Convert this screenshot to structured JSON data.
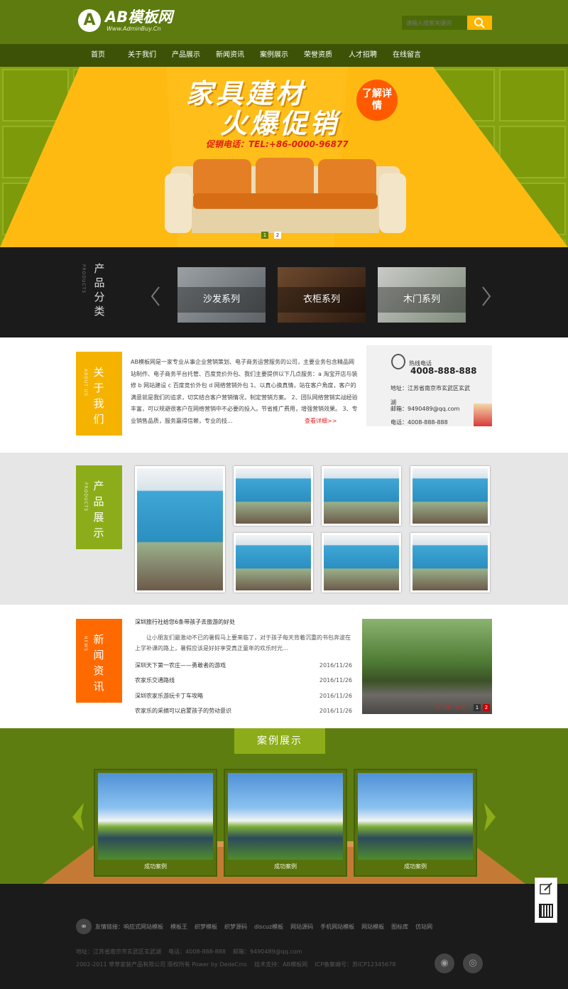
{
  "header": {
    "logo_text": "AB模板网",
    "logo_url": "Www.AdminBuy.Cn",
    "search_placeholder": "请输入搜索关键词"
  },
  "nav": [
    "首页",
    "关于我们",
    "产品展示",
    "新闻资讯",
    "案例展示",
    "荣誉资质",
    "人才招聘",
    "在线留言"
  ],
  "banner": {
    "title_line1": "家具建材",
    "title_line2": "火爆促销",
    "badge": "了解详情",
    "phone": "促销电话：TEL:+86-0000-96877",
    "dots": [
      "1",
      "2"
    ]
  },
  "categories": {
    "title": "产品分类",
    "subtitle": "PRODUCTS",
    "items": [
      "沙发系列",
      "衣柜系列",
      "木门系列"
    ]
  },
  "about": {
    "title": "关于我们",
    "subtitle": "ABOUT US",
    "text": "AB模板网是一家专业从事企业营销策划、电子商务运营服务的公司，主要业务包含精品网站制作、电子商务平台托管、百度竞价外包、我们主要提供以下几点服务：a 淘宝开店与装修 b 网站建设 c 百度竞价外包 d 网络营销外包 1、以真心换真情，站在客户角度，客户的满意就是我们的追求，切实结合客户营销情况，制定营销方案。 2、团队网络营销实战经验丰富，可以规避很客户在网络营销中不必要的投入。节省推广费用，增强营销效果。 3、专业销售品质，服务赢得信赖，专业的技...",
    "more": "查看详细>>",
    "hotline_label": "热线电话",
    "hotline": "4008-888-888",
    "address": "地址：江苏省南京市玄武区玄武湖",
    "email": "邮箱：9490489@qq.com",
    "phone": "电话：4008-888-888"
  },
  "products": {
    "title": "产品展示",
    "subtitle": "PRODUCTS"
  },
  "news": {
    "title": "新闻资讯",
    "subtitle": "NEWS",
    "headline": "深圳旅行社给您6条带孩子去旅游的好处",
    "summary": "让小朋友们最激动不已的暑假马上要来临了，对于孩子每天背着沉重的书包奔波在上学补课的路上，暑假应该是好好享受真正童年的欢乐时光...",
    "items": [
      {
        "title": "深圳天下第一农庄——勇敢者的游戏",
        "date": "2016/11/26"
      },
      {
        "title": "农家乐交通路线",
        "date": "2016/11/26"
      },
      {
        "title": "深圳农家乐游玩卡丁车攻略",
        "date": "2016/11/26"
      },
      {
        "title": "农家乐的采摘可以启蒙孩子的劳动意识",
        "date": "2016/11/26"
      }
    ],
    "photo_caption": "天下第一农庄",
    "photo_pages": [
      "1",
      "2"
    ]
  },
  "cases": {
    "title": "案例展示",
    "items": [
      "成功案例",
      "成功案例",
      "成功案例"
    ]
  },
  "footer": {
    "links_label": "友情链接：",
    "links": [
      "响应式网站模板",
      "模板王",
      "织梦模板",
      "织梦源码",
      "discuz模板",
      "网站源码",
      "手机网站模板",
      "网站模板",
      "图标库",
      "仿站网"
    ],
    "address_line": "地址：江苏省南京市玄武区玄武湖    电话：4008-888-888    邮箱：9490489@qq.com",
    "copyright": "2002-2011 草草家装产品有限公司 版权所有 Power by DedeCms    技术支持：AB模板网    ICP备案编号：苏ICP12345678"
  },
  "colors": {
    "header_green": "#5e7d10",
    "nav_green": "#3e5208",
    "banner_yellow": "#ffb90f",
    "accent_orange": "#ff5a00",
    "about_yellow": "#f5b300",
    "product_green": "#8cad19",
    "news_orange": "#ff6a00",
    "dark": "#1b1b1b"
  }
}
